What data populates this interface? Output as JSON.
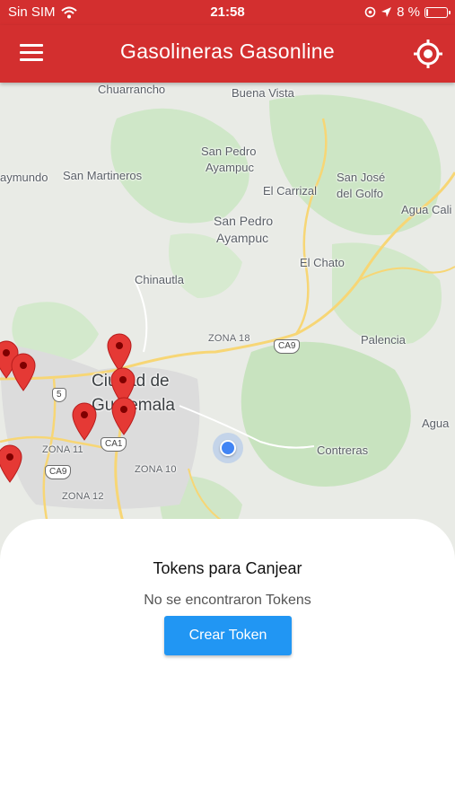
{
  "status_bar": {
    "carrier": "Sin SIM",
    "time": "21:58",
    "battery": "8 %",
    "battery_level": 0.08
  },
  "app_bar": {
    "title": "Gasolineras Gasonline",
    "menu_icon": "hamburger-menu-icon",
    "locate_icon": "gps-locate-icon"
  },
  "map": {
    "labels": {
      "chuarrancho": "Chuarrancho",
      "buena_vista": "Buena Vista",
      "san_pedro_1": "San Pedro",
      "ayampuc_1": "Ayampuc",
      "raymundo": "aymundo",
      "san_martineros": "San Martineros",
      "el_carrizal": "El Carrizal",
      "san_jose_1": "San José",
      "del_golfo": "del Golfo",
      "agua_cali": "Agua Cali",
      "san_pedro_2": "San Pedro",
      "ayampuc_2": "Ayampuc",
      "el_chato": "El Chato",
      "chinautla": "Chinautla",
      "zona_18": "ZONA 18",
      "palencia": "Palencia",
      "ciudad_1": "Ciudad de",
      "ciudad_2": "Guatemala",
      "agua": "Agua",
      "zona_11": "ZONA 11",
      "zona_10": "ZONA 10",
      "contreras": "Contreras",
      "zona_12": "ZONA 12"
    },
    "shields": {
      "ca9_east": "CA9",
      "r5": "5",
      "ca1": "CA1",
      "ca9_west": "CA9"
    },
    "pin_color": "#e53935",
    "location_color": "#4285f4"
  },
  "sheet": {
    "heading": "Tokens para Canjear",
    "empty_message": "No se encontraron Tokens",
    "create_button": "Crear Token"
  },
  "colors": {
    "primary": "#d32f2f",
    "button": "#2196f3"
  }
}
